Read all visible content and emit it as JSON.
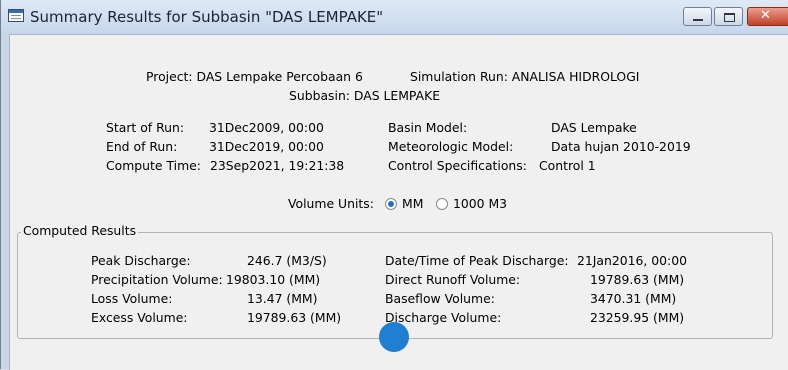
{
  "window": {
    "title": "Summary Results for Subbasin \"DAS LEMPAKE\""
  },
  "header": {
    "project_line": "Project: DAS Lempake Percobaan 6",
    "simulation_line": "Simulation Run: ANALISA HIDROLOGI",
    "subbasin_line": "Subbasin: DAS LEMPAKE"
  },
  "run_info": {
    "start_label": "Start of Run:",
    "start_value": "31Dec2009, 00:00",
    "end_label": "End of Run:",
    "end_value": "31Dec2019, 00:00",
    "compute_label": "Compute Time:",
    "compute_value": "23Sep2021, 19:21:38",
    "basin_label": "Basin Model:",
    "basin_value": "DAS Lempake",
    "met_label": "Meteorologic Model:",
    "met_value": "Data hujan 2010-2019",
    "control_label": "Control Specifications:",
    "control_value": "Control 1"
  },
  "volume_units": {
    "label": "Volume Units:",
    "options": [
      "MM",
      "1000 M3"
    ],
    "selected": "MM"
  },
  "computed_results": {
    "legend": "Computed Results",
    "left": [
      {
        "label": "Peak Discharge:",
        "value": "246.7 (M3/S)"
      },
      {
        "label": "Precipitation Volume:",
        "value": "19803.10 (MM)"
      },
      {
        "label": "Loss Volume:",
        "value": "13.47 (MM)"
      },
      {
        "label": "Excess Volume:",
        "value": "19789.63 (MM)"
      }
    ],
    "right": [
      {
        "label": "Date/Time of Peak Discharge:",
        "value": "21Jan2016, 00:00"
      },
      {
        "label": "Direct Runoff Volume:",
        "value": "19789.63 (MM)"
      },
      {
        "label": "Baseflow Volume:",
        "value": "3470.31 (MM)"
      },
      {
        "label": "Discharge Volume:",
        "value": "23259.95 (MM)"
      }
    ]
  },
  "icons": {
    "window_icon": "table-window-icon",
    "minimize": "minimize-icon",
    "maximize": "maximize-icon",
    "close": "close-icon"
  },
  "colors": {
    "titlebar": "#c6d6ea",
    "close_button": "#c4402a",
    "radio_selected": "#2a6cc0",
    "panel_bg": "#f0f0f0"
  }
}
